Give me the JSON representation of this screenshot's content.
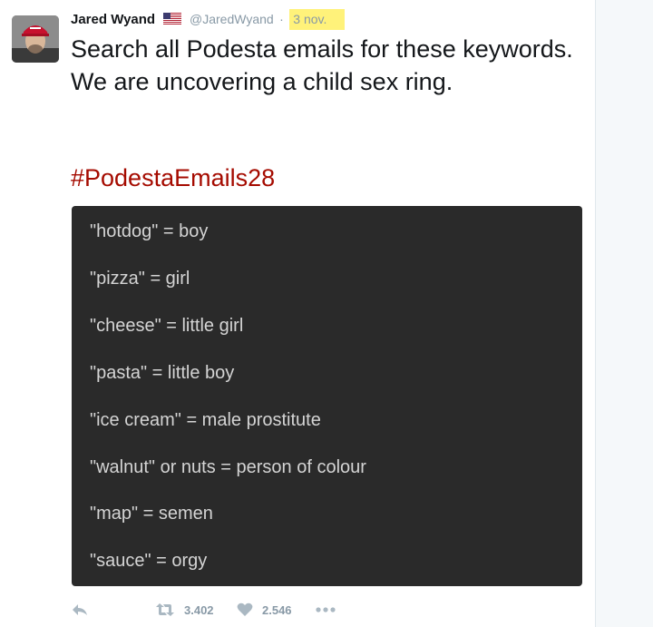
{
  "tweet": {
    "display_name": "Jared Wyand",
    "handle": "@JaredWyand",
    "separator": "·",
    "date": "3 nov.",
    "text": "Search all Podesta emails for these keywords. We are uncovering a child sex ring.",
    "hashtag": "#PodestaEmails28"
  },
  "media": {
    "lines": [
      "\"hotdog\" = boy",
      "\"pizza\" = girl",
      "\"cheese\" = little girl",
      "\"pasta\" = little boy",
      "\"ice cream\" = male prostitute",
      "\"walnut\" or nuts = person of colour",
      "\"map\" = semen",
      "\"sauce\" = orgy"
    ]
  },
  "actions": {
    "retweet_count": "3.402",
    "like_count": "2.546",
    "icons": [
      "reply-icon",
      "retweet-icon",
      "like-icon",
      "more-icon"
    ]
  },
  "colors": {
    "hashtag": "#a50b00",
    "date_highlight": "#fff27a",
    "media_background": "#2a2a2a",
    "muted": "#8899a6"
  }
}
